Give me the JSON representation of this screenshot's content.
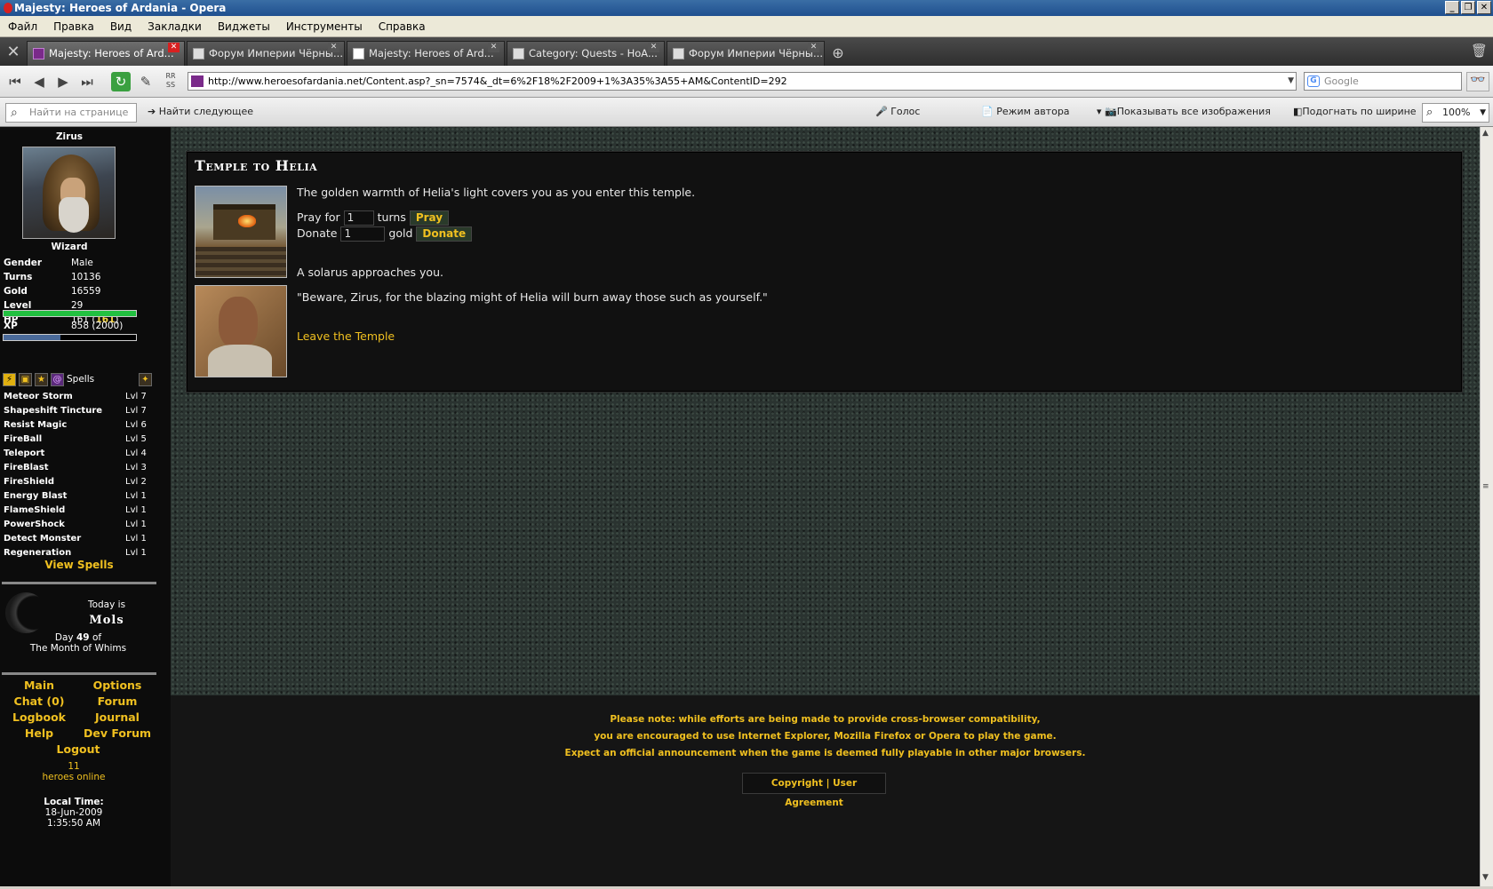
{
  "window": {
    "title": "Majesty: Heroes of Ardania - Opera"
  },
  "menu": [
    "Файл",
    "Правка",
    "Вид",
    "Закладки",
    "Виджеты",
    "Инструменты",
    "Справка"
  ],
  "tabs": [
    {
      "label": "Majesty: Heroes of Ard...",
      "icon": "hoa-favicon"
    },
    {
      "label": "Форум Империи Чёрны...",
      "icon": "forum-favicon"
    },
    {
      "label": "Majesty: Heroes of Ard...",
      "icon": "google-favicon"
    },
    {
      "label": "Category: Quests - HoA...",
      "icon": "document-icon"
    },
    {
      "label": "Форум Империи Чёрны...",
      "icon": "forum-favicon"
    }
  ],
  "address": {
    "url": "http://www.heroesofardania.net/Content.asp?_sn=7574&_dt=6%2F18%2F2009+1%3A35%3A55+AM&ContentID=292"
  },
  "search": {
    "placeholder": "Google"
  },
  "findbar": {
    "placeholder": "Найти на странице",
    "find_next": "Найти следующее",
    "voice": "Голос",
    "author_mode": "Режим автора",
    "show_images": "Показывать все изображения",
    "fit_width": "Подогнать по ширине",
    "zoom": "100%"
  },
  "character": {
    "name": "Zirus",
    "class": "Wizard",
    "stats": [
      {
        "label": "Gender",
        "value": "Male"
      },
      {
        "label": "Turns",
        "value": "10136"
      },
      {
        "label": "Gold",
        "value": "16559"
      },
      {
        "label": "Level",
        "value": "29"
      }
    ],
    "hp": {
      "label": "HP",
      "current": "161",
      "max": "161",
      "fraction": 1.0
    },
    "xp": {
      "label": "XP",
      "current": "858",
      "max": "2000",
      "fraction": 0.43
    },
    "spells_label": "Spells"
  },
  "spells": [
    {
      "name": "Meteor Storm",
      "level": "Lvl 7"
    },
    {
      "name": "Shapeshift Tincture",
      "level": "Lvl 7"
    },
    {
      "name": "Resist Magic",
      "level": "Lvl 6"
    },
    {
      "name": "FireBall",
      "level": "Lvl 5"
    },
    {
      "name": "Teleport",
      "level": "Lvl 4"
    },
    {
      "name": "FireBlast",
      "level": "Lvl 3"
    },
    {
      "name": "FireShield",
      "level": "Lvl 2"
    },
    {
      "name": "Energy Blast",
      "level": "Lvl 1"
    },
    {
      "name": "FlameShield",
      "level": "Lvl 1"
    },
    {
      "name": "PowerShock",
      "level": "Lvl 1"
    },
    {
      "name": "Detect Monster",
      "level": "Lvl 1"
    },
    {
      "name": "Regeneration",
      "level": "Lvl 1"
    }
  ],
  "view_spells": "View Spells",
  "calendar": {
    "today_is": "Today is",
    "day_name": "Mols",
    "day_prefix": "Day",
    "day_number": "49",
    "day_suffix": "of",
    "month": "The Month of Whims"
  },
  "nav": {
    "main": "Main",
    "options": "Options",
    "chat": "Chat (0)",
    "forum": "Forum",
    "logbook": "Logbook",
    "journal": "Journal",
    "help": "Help",
    "dev_forum": "Dev Forum",
    "logout": "Logout"
  },
  "online": {
    "count": "11",
    "label": "heroes online"
  },
  "local_time": {
    "label": "Local Time:",
    "date": "18-Jun-2009",
    "time": "1:35:50 AM"
  },
  "temple": {
    "title": "Temple to Helia",
    "intro": "The golden warmth of Helia's light covers you as you enter this temple.",
    "pray_prefix": "Pray for",
    "pray_value": "1",
    "pray_suffix": "turns",
    "pray_button": "Pray",
    "donate_prefix": "Donate",
    "donate_value": "1",
    "donate_suffix": "gold",
    "donate_button": "Donate",
    "approach": "A solarus approaches you.",
    "quote": "\"Beware, Zirus, for the blazing might of Helia will burn away those such as yourself.\"",
    "leave": "Leave the Temple"
  },
  "footer": {
    "notice_lines": [
      "Please note: while efforts are being made to provide cross-browser compatibility,",
      "you are encouraged to use Internet Explorer, Mozilla Firefox or Opera to play the game.",
      "Expect an official announcement when the game is deemed fully playable in other major browsers."
    ],
    "copyright": "Copyright",
    "separator": "|",
    "agreement": "User Agreement"
  },
  "colors": {
    "accent_gold": "#f0c020",
    "hp_bar": "#22c040",
    "xp_bar": "#4a6a9a"
  }
}
